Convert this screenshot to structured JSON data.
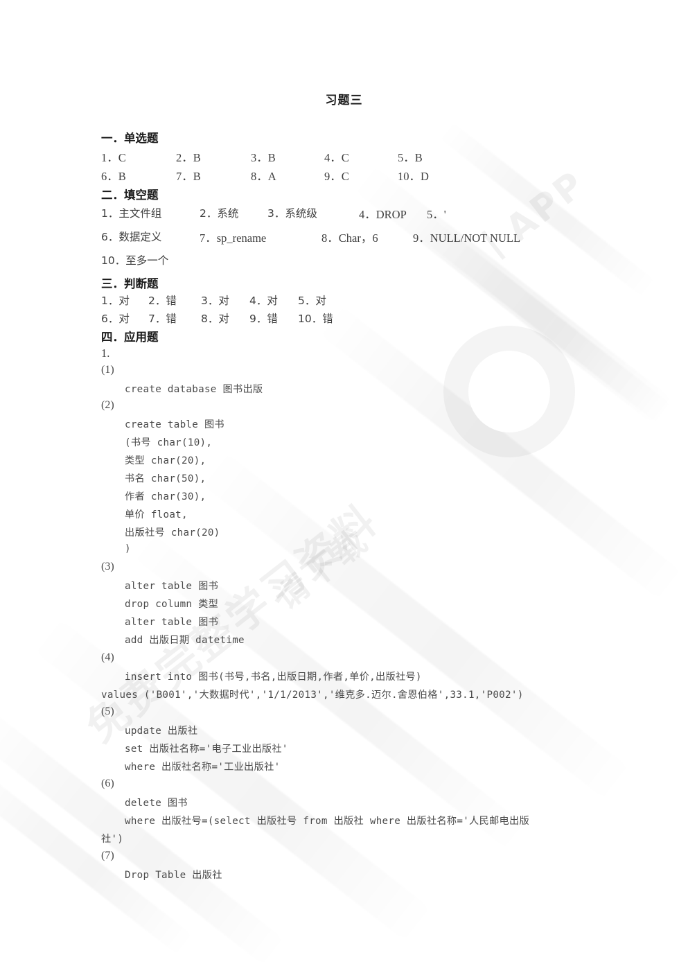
{
  "document": {
    "title": "习题三"
  },
  "sections": [
    {
      "id": "single-choice",
      "heading": "一．单选题",
      "rows": [
        [
          "1．C",
          "2．B",
          "3．B",
          "4．C",
          "5．B"
        ],
        [
          "6．B",
          "7．B",
          "8．A",
          "9．C",
          "10．D"
        ]
      ]
    },
    {
      "id": "fill-in-blank",
      "heading": "二．填空题",
      "rows": [
        [
          "1．主文件组",
          "2．系统",
          "3．系统级",
          "4．DROP",
          "5．'"
        ],
        [
          "6．数据定义",
          "7．sp_rename",
          "8．Char，6",
          "9．NULL/NOT NULL"
        ],
        [
          "10．至多一个"
        ]
      ]
    },
    {
      "id": "true-false",
      "heading": "三．判断题",
      "rows": [
        [
          "1．对",
          "2．错",
          "3．对",
          "4．对",
          "5．对"
        ],
        [
          "6．对",
          "7．错",
          "8．对",
          "9．错",
          "10．错"
        ]
      ]
    },
    {
      "id": "application",
      "heading": "四．应用题",
      "question_number": "1."
    }
  ],
  "application_items": [
    {
      "label": "(1)",
      "lines": [
        "create database 图书出版"
      ]
    },
    {
      "label": "(2)",
      "lines": [
        "create table 图书",
        "(书号 char(10),",
        "类型 char(20),",
        "书名 char(50),",
        "作者 char(30),",
        "单价 float,",
        "出版社号 char(20)",
        ")"
      ]
    },
    {
      "label": "(3)",
      "lines": [
        "alter table 图书",
        "drop column 类型",
        "alter table 图书",
        "add 出版日期 datetime"
      ]
    },
    {
      "label": "(4)",
      "lines": [
        "insert into 图书(书号,书名,出版日期,作者,单价,出版社号)",
        "values ('B001','大数据时代','1/1/2013','维克多.迈尔.舍恩伯格',33.1,'P002')"
      ]
    },
    {
      "label": "(5)",
      "lines": [
        "update 出版社",
        "set 出版社名称='电子工业出版社'",
        "where 出版社名称='工业出版社'"
      ]
    },
    {
      "label": "(6)",
      "lines": [
        "delete 图书",
        "where 出版社号=(select 出版社号 from 出版社 where 出版社名称='人民邮电出版",
        "社')"
      ]
    },
    {
      "label": "(7)",
      "lines": [
        "Drop Table 出版社"
      ]
    }
  ],
  "watermark": {
    "primary": "免费完整学习资料",
    "secondary": "请下载",
    "brand": "资小搜丨APP"
  }
}
